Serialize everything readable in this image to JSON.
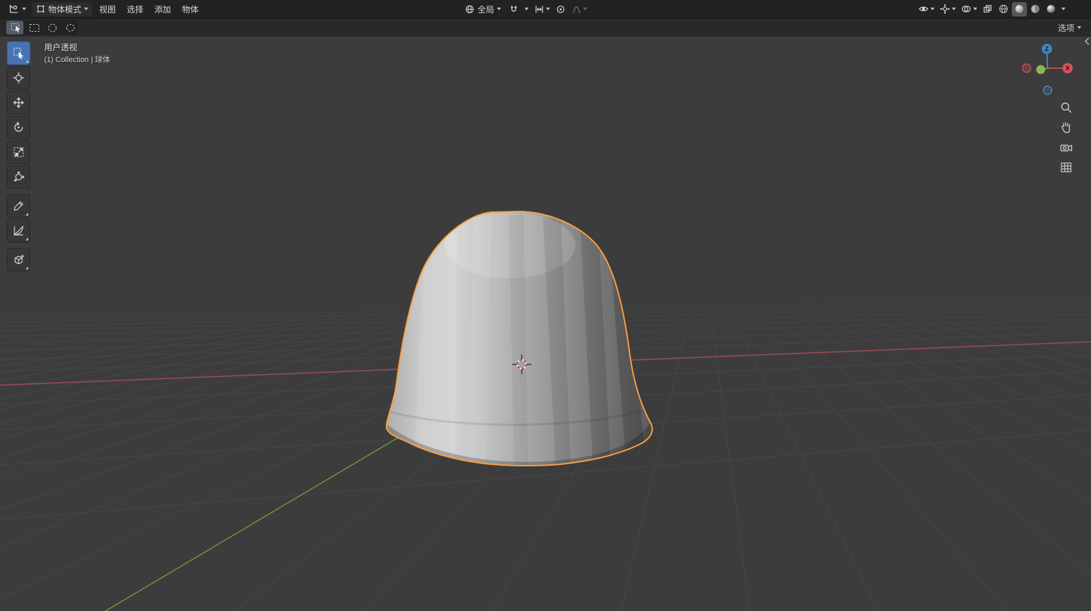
{
  "header": {
    "mode_label": "物体模式",
    "menus": [
      {
        "label": "视图"
      },
      {
        "label": "选择"
      },
      {
        "label": "添加"
      },
      {
        "label": "物体"
      }
    ],
    "orientation_label": "全局"
  },
  "tool_settings": {
    "options_label": "选项"
  },
  "viewport": {
    "view_label": "用户透视",
    "breadcrumb": "(1) Collection | 球体",
    "gizmo": {
      "z": "Z",
      "x": "X"
    }
  },
  "colors": {
    "selection_outline": "#ff9e3d",
    "active_tool": "#4772b3",
    "axis_x": "#a34a52",
    "axis_y": "#6f9c3d",
    "viewport_bg": "#3c3c3c",
    "header_bg": "#222222"
  }
}
